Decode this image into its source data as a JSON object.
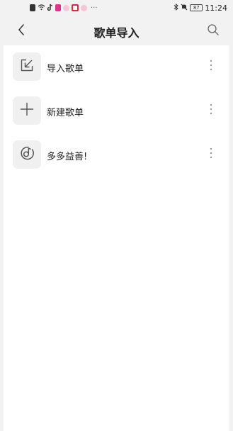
{
  "status_bar": {
    "time": "11:24",
    "battery": "87",
    "icons": [
      "notification-icon",
      "wifi-icon",
      "tiktok-icon",
      "app-icon",
      "baby-icon",
      "red-app-icon",
      "baby-icon"
    ],
    "more": "···"
  },
  "header": {
    "title": "歌单导入",
    "back_icon": "chevron-left-icon",
    "search_icon": "search-icon"
  },
  "list": {
    "items": [
      {
        "label": "导入歌单",
        "icon": "import-arrow-icon"
      },
      {
        "label": "新建歌单",
        "icon": "plus-icon"
      },
      {
        "label": "多多益善!",
        "icon": "music-disc-icon"
      }
    ]
  },
  "colors": {
    "background": "#f2f2f2",
    "panel": "#ffffff",
    "icon_box": "#f0f0f0",
    "icon_stroke": "#555555"
  }
}
